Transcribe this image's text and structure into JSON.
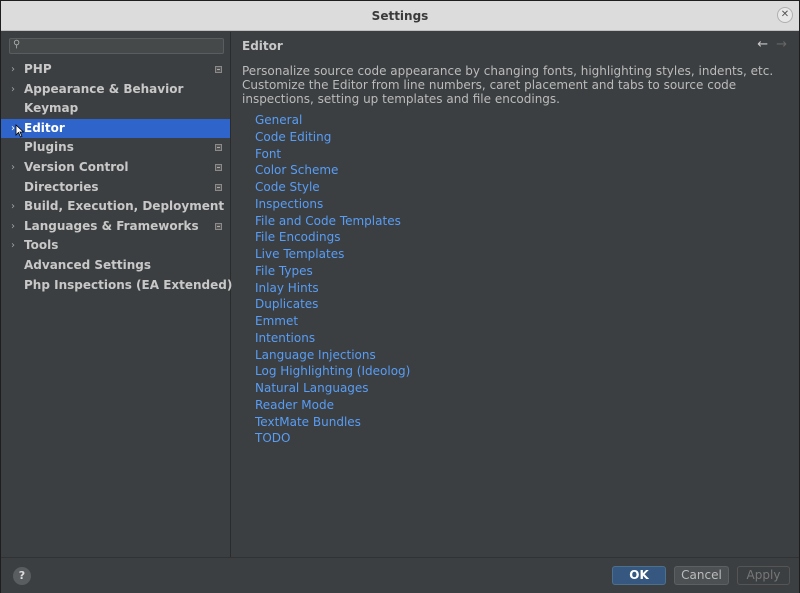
{
  "window": {
    "title": "Settings"
  },
  "search": {
    "placeholder": ""
  },
  "sidebar": {
    "items": [
      {
        "label": "PHP",
        "chevron": true,
        "badge": true,
        "selected": false
      },
      {
        "label": "Appearance & Behavior",
        "chevron": true,
        "badge": false,
        "selected": false
      },
      {
        "label": "Keymap",
        "chevron": false,
        "badge": false,
        "selected": false
      },
      {
        "label": "Editor",
        "chevron": true,
        "badge": false,
        "selected": true
      },
      {
        "label": "Plugins",
        "chevron": false,
        "badge": true,
        "selected": false
      },
      {
        "label": "Version Control",
        "chevron": true,
        "badge": true,
        "selected": false
      },
      {
        "label": "Directories",
        "chevron": false,
        "badge": true,
        "selected": false
      },
      {
        "label": "Build, Execution, Deployment",
        "chevron": true,
        "badge": false,
        "selected": false
      },
      {
        "label": "Languages & Frameworks",
        "chevron": true,
        "badge": true,
        "selected": false
      },
      {
        "label": "Tools",
        "chevron": true,
        "badge": false,
        "selected": false
      },
      {
        "label": "Advanced Settings",
        "chevron": false,
        "badge": false,
        "selected": false
      },
      {
        "label": "Php Inspections (EA Extended)",
        "chevron": false,
        "badge": false,
        "selected": false
      }
    ]
  },
  "content": {
    "header": "Editor",
    "description": "Personalize source code appearance by changing fonts, highlighting styles, indents, etc. Customize the Editor from line numbers, caret placement and tabs to source code inspections, setting up templates and file encodings.",
    "links": [
      "General",
      "Code Editing",
      "Font",
      "Color Scheme",
      "Code Style",
      "Inspections",
      "File and Code Templates",
      "File Encodings",
      "Live Templates",
      "File Types",
      "Inlay Hints",
      "Duplicates",
      "Emmet",
      "Intentions",
      "Language Injections",
      "Log Highlighting (Ideolog)",
      "Natural Languages",
      "Reader Mode",
      "TextMate Bundles",
      "TODO"
    ]
  },
  "footer": {
    "help_label": "?",
    "ok_label": "OK",
    "cancel_label": "Cancel",
    "apply_label": "Apply"
  },
  "colors": {
    "accent": "#2f65ca",
    "link": "#589df6",
    "background": "#3c3f41"
  }
}
